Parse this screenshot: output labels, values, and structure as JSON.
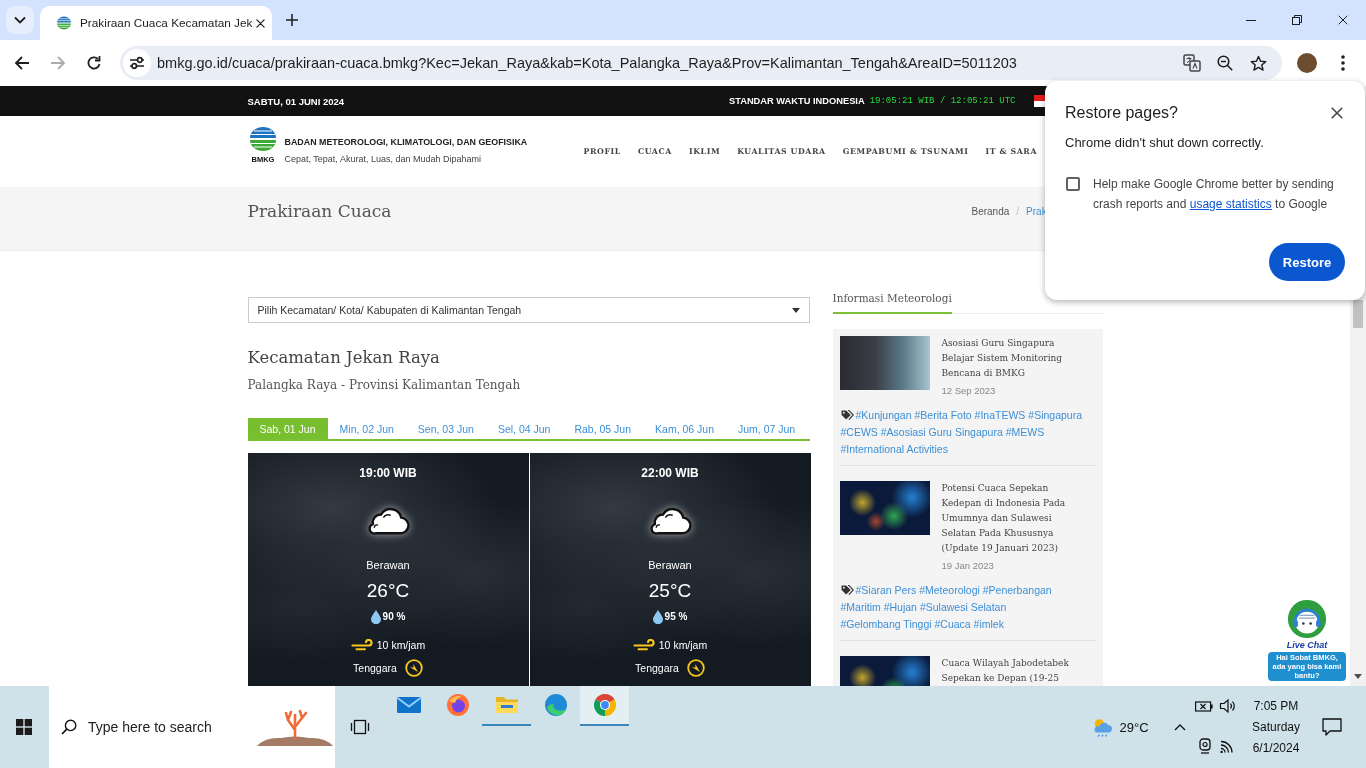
{
  "browser": {
    "tab_title": "Prakiraan Cuaca Kecamatan Jek",
    "forward_disabled": true,
    "url": "bmkg.go.id/cuaca/prakiraan-cuaca.bmkg?Kec=Jekan_Raya&kab=Kota_Palangka_Raya&Prov=Kalimantan_Tengah&AreaID=5011203"
  },
  "topbar": {
    "date": "SABTU, 01 JUNI 2024",
    "time_label": "STANDAR WAKTU INDONESIA",
    "clock": "19:05:21 WIB / 12:05:21 UTC"
  },
  "header": {
    "logo_text": "BMKG",
    "title": "BADAN METEOROLOGI, KLIMATOLOGI, DAN GEOFISIKA",
    "tagline": "Cepat, Tepat, Akurat, Luas, dan Mudah Dipahami",
    "nav": [
      "PROFIL",
      "CUACA",
      "IKLIM",
      "KUALITAS UDARA",
      "GEMPABUMI & TSUNAMI",
      "IT & SARA"
    ]
  },
  "page_title": {
    "title": "Prakiraan Cuaca",
    "separator": "/",
    "breadcrumb": [
      {
        "label": "Beranda",
        "current": false
      },
      {
        "label": "Prak",
        "current": true
      }
    ]
  },
  "location_select": {
    "value": "Pilih Kecamatan/ Kota/ Kabupaten di Kalimantan Tengah"
  },
  "location": {
    "name": "Kecamatan Jekan Raya",
    "region": "Palangka Raya - Provinsi Kalimantan Tengah"
  },
  "day_tabs": [
    {
      "label": "Sab, 01 Jun",
      "selected": true
    },
    {
      "label": "Min, 02 Jun",
      "selected": false
    },
    {
      "label": "Sen, 03 Jun",
      "selected": false
    },
    {
      "label": "Sel, 04 Jun",
      "selected": false
    },
    {
      "label": "Rab, 05 Jun",
      "selected": false
    },
    {
      "label": "Kam, 06 Jun",
      "selected": false
    },
    {
      "label": "Jum, 07 Jun",
      "selected": false
    }
  ],
  "forecasts": [
    {
      "time": "19:00 WIB",
      "condition": "Berawan",
      "temperature": "26°C",
      "humidity": "90 %",
      "wind_speed": "10 km/jam",
      "wind_direction": "Tenggara"
    },
    {
      "time": "22:00 WIB",
      "condition": "Berawan",
      "temperature": "25°C",
      "humidity": "95 %",
      "wind_speed": "10 km/jam",
      "wind_direction": "Tenggara"
    }
  ],
  "sidebar": {
    "heading": "Informasi Meteorologi",
    "news": [
      {
        "kind": "photo",
        "title": "Asosiasi Guru Singapura Belajar Sistem Monitoring Bencana di BMKG",
        "date": "12 Sep 2023",
        "tags": [
          "#Kunjungan",
          "#Berita Foto",
          "#InaTEWS",
          "#Singapura",
          "#CEWS",
          "#Asosiasi Guru Singapura",
          "#MEWS",
          "#International Activities"
        ]
      },
      {
        "kind": "map",
        "title": "Potensi Cuaca Sepekan Kedepan di Indonesia Pada Umumnya dan Sulawesi Selatan Pada Khususnya (Update 19 Januari 2023)",
        "date": "19 Jan 2023",
        "tags": [
          "#Siaran Pers",
          "#Meteorologi",
          "#Penerbangan",
          "#Maritim",
          "#Hujan",
          "#Sulawesi Selatan",
          "#Gelombang Tinggi",
          "#Cuaca",
          "#imlek"
        ]
      },
      {
        "kind": "map",
        "title": "Cuaca Wilayah Jabodetabek Sepekan ke Depan (19-25"
      }
    ]
  },
  "restore_dialog": {
    "title": "Restore pages?",
    "message": "Chrome didn't shut down correctly.",
    "checked": false,
    "consent_before": "Help make Google Chrome better by sending crash reports and ",
    "consent_link": "usage statistics",
    "consent_after": " to Google",
    "button": "Restore"
  },
  "live_chat": {
    "label": "Live Chat",
    "bubble": "Hai Sobat BMKG, ada yang bisa kami bantu?"
  },
  "taskbar": {
    "search_placeholder": "Type here to search",
    "apps": [
      {
        "running": false,
        "active": false
      },
      {
        "running": false,
        "active": false
      },
      {
        "running": true,
        "active": false
      },
      {
        "running": false,
        "active": false
      },
      {
        "running": true,
        "active": true
      }
    ],
    "temperature": "29°C",
    "time": "7:05 PM",
    "day": "Saturday",
    "date": "6/1/2024"
  }
}
